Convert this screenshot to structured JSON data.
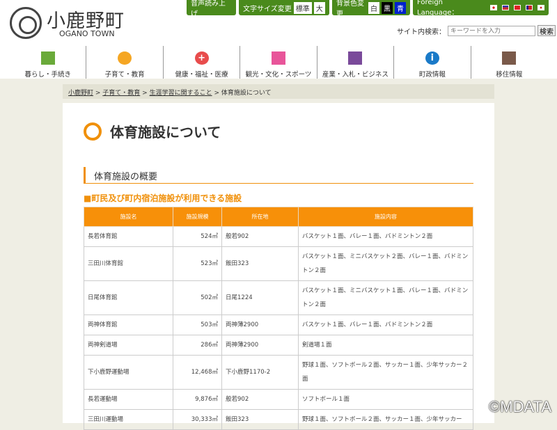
{
  "site": {
    "name": "小鹿野町",
    "name_en": "OGANO TOWN"
  },
  "toolbar": {
    "speech": "音声読み上げ",
    "font_size": "文字サイズ変更",
    "font_std": "標準",
    "font_large": "大",
    "bg": "背景色変更",
    "bg_white": "白",
    "bg_black": "黒",
    "bg_blue": "青",
    "foreign": "Foreign Language："
  },
  "search": {
    "label": "サイト内検索：",
    "placeholder": "キーワードを入力",
    "button": "検索"
  },
  "nav": [
    {
      "label": "暮らし・手続き",
      "icon": "house-icon",
      "color": "#6aaa3a"
    },
    {
      "label": "子育て・教育",
      "icon": "child-icon",
      "color": "#f5a623"
    },
    {
      "label": "健康・福祉・医療",
      "icon": "plus-icon",
      "color": "#e84c4c"
    },
    {
      "label": "観光・文化・スポーツ",
      "icon": "flower-icon",
      "color": "#e8559a"
    },
    {
      "label": "産業・入札・ビジネス",
      "icon": "factory-icon",
      "color": "#7a4a9a"
    },
    {
      "label": "町政情報",
      "icon": "info-icon",
      "color": "#1a7ac8"
    },
    {
      "label": "移住情報",
      "icon": "home-icon",
      "color": "#7a5a4a"
    }
  ],
  "breadcrumb": {
    "items": [
      "小鹿野町",
      "子育て・教育",
      "生涯学習に関すること"
    ],
    "current": "体育施設について",
    "sep": " > "
  },
  "page": {
    "title": "体育施設について",
    "h2": "体育施設の概要",
    "h3": "■町民及び町内宿泊施設が利用できる施設"
  },
  "table": {
    "headers": [
      "施設名",
      "施設規模",
      "所在地",
      "施設内容"
    ],
    "rows": [
      [
        "長若体育館",
        "524㎡",
        "般若902",
        "バスケット１面、バレー１面、バドミントン２面"
      ],
      [
        "三田川体育館",
        "523㎡",
        "飯田323",
        "バスケット１面、ミニバスケット２面、バレー１面、バドミントン２面"
      ],
      [
        "日尾体育館",
        "502㎡",
        "日尾1224",
        "バスケット１面、ミニバスケット１面、バレー１面、バドミントン２面"
      ],
      [
        "両神体育館",
        "503㎡",
        "両神薄2900",
        "バスケット１面、バレー１面、バドミントン２面"
      ],
      [
        "両神剣道場",
        "286㎡",
        "両神薄2900",
        "剣道場１面"
      ],
      [
        "下小鹿野運動場",
        "12,468㎡",
        "下小鹿野1170-2",
        "野球１面、ソフトボール２面、サッカー１面、少年サッカー２面"
      ],
      [
        "長若運動場",
        "9,876㎡",
        "般若902",
        "ソフトボール１面"
      ],
      [
        "三田川運動場",
        "30,333㎡",
        "飯田323",
        "野球１面、ソフトボール２面、サッカー１面、少年サッカー"
      ]
    ]
  },
  "watermark": "©MDATA"
}
